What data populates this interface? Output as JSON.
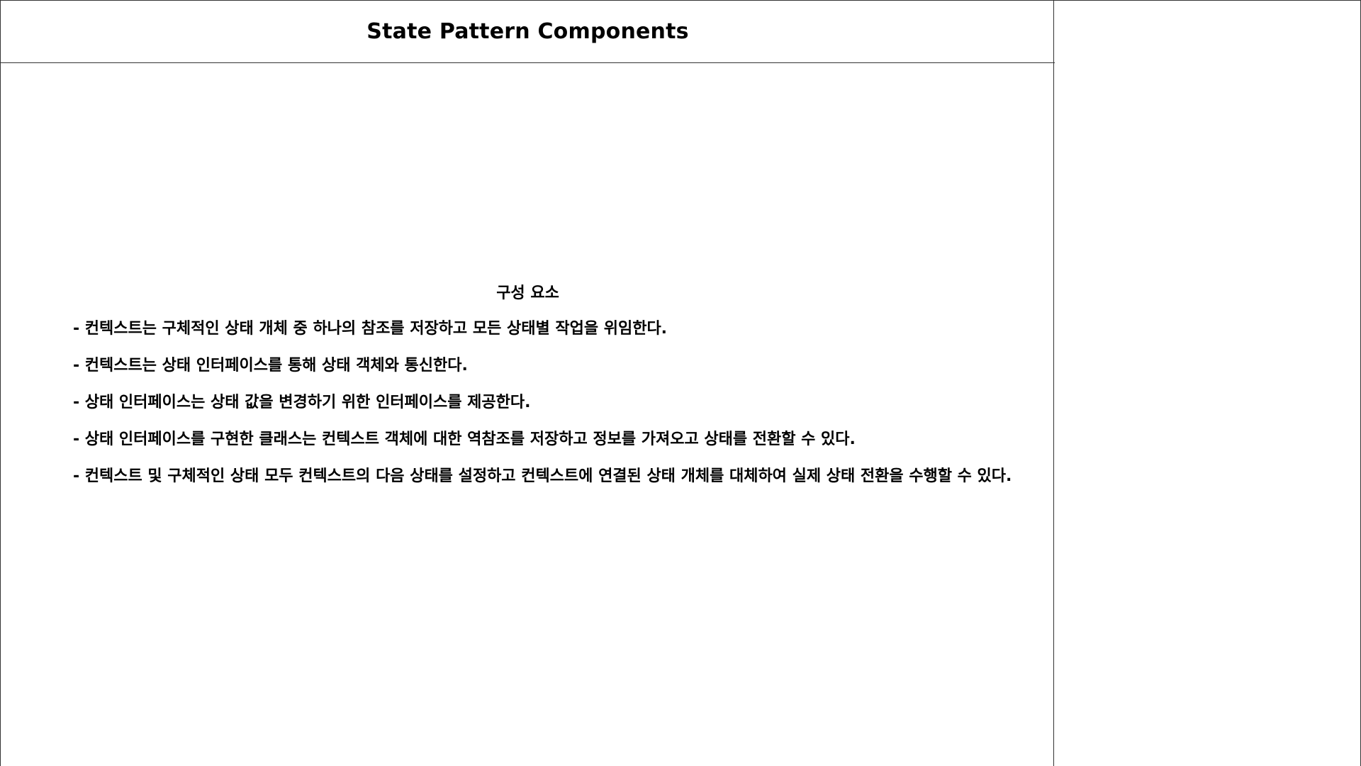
{
  "slide": {
    "title": "State Pattern Components",
    "section_heading": "구성 요소",
    "bullets": [
      "- 컨텍스트는 구체적인 상태 개체 중 하나의 참조를 저장하고 모든 상태별 작업을 위임한다.",
      "- 컨텍스트는 상태 인터페이스를 통해 상태 객체와 통신한다.",
      "- 상태 인터페이스는 상태 값을 변경하기 위한 인터페이스를 제공한다.",
      "- 상태 인터페이스를 구현한 클래스는 컨텍스트 객체에 대한 역참조를 저장하고 정보를 가져오고 상태를 전환할 수 있다.",
      "- 컨텍스트 및 구체적인 상태 모두 컨텍스트의 다음 상태를 설정하고 컨텍스트에 연결된 상태 개체를 대체하여 실제 상태 전환을 수행할 수 있다."
    ]
  }
}
